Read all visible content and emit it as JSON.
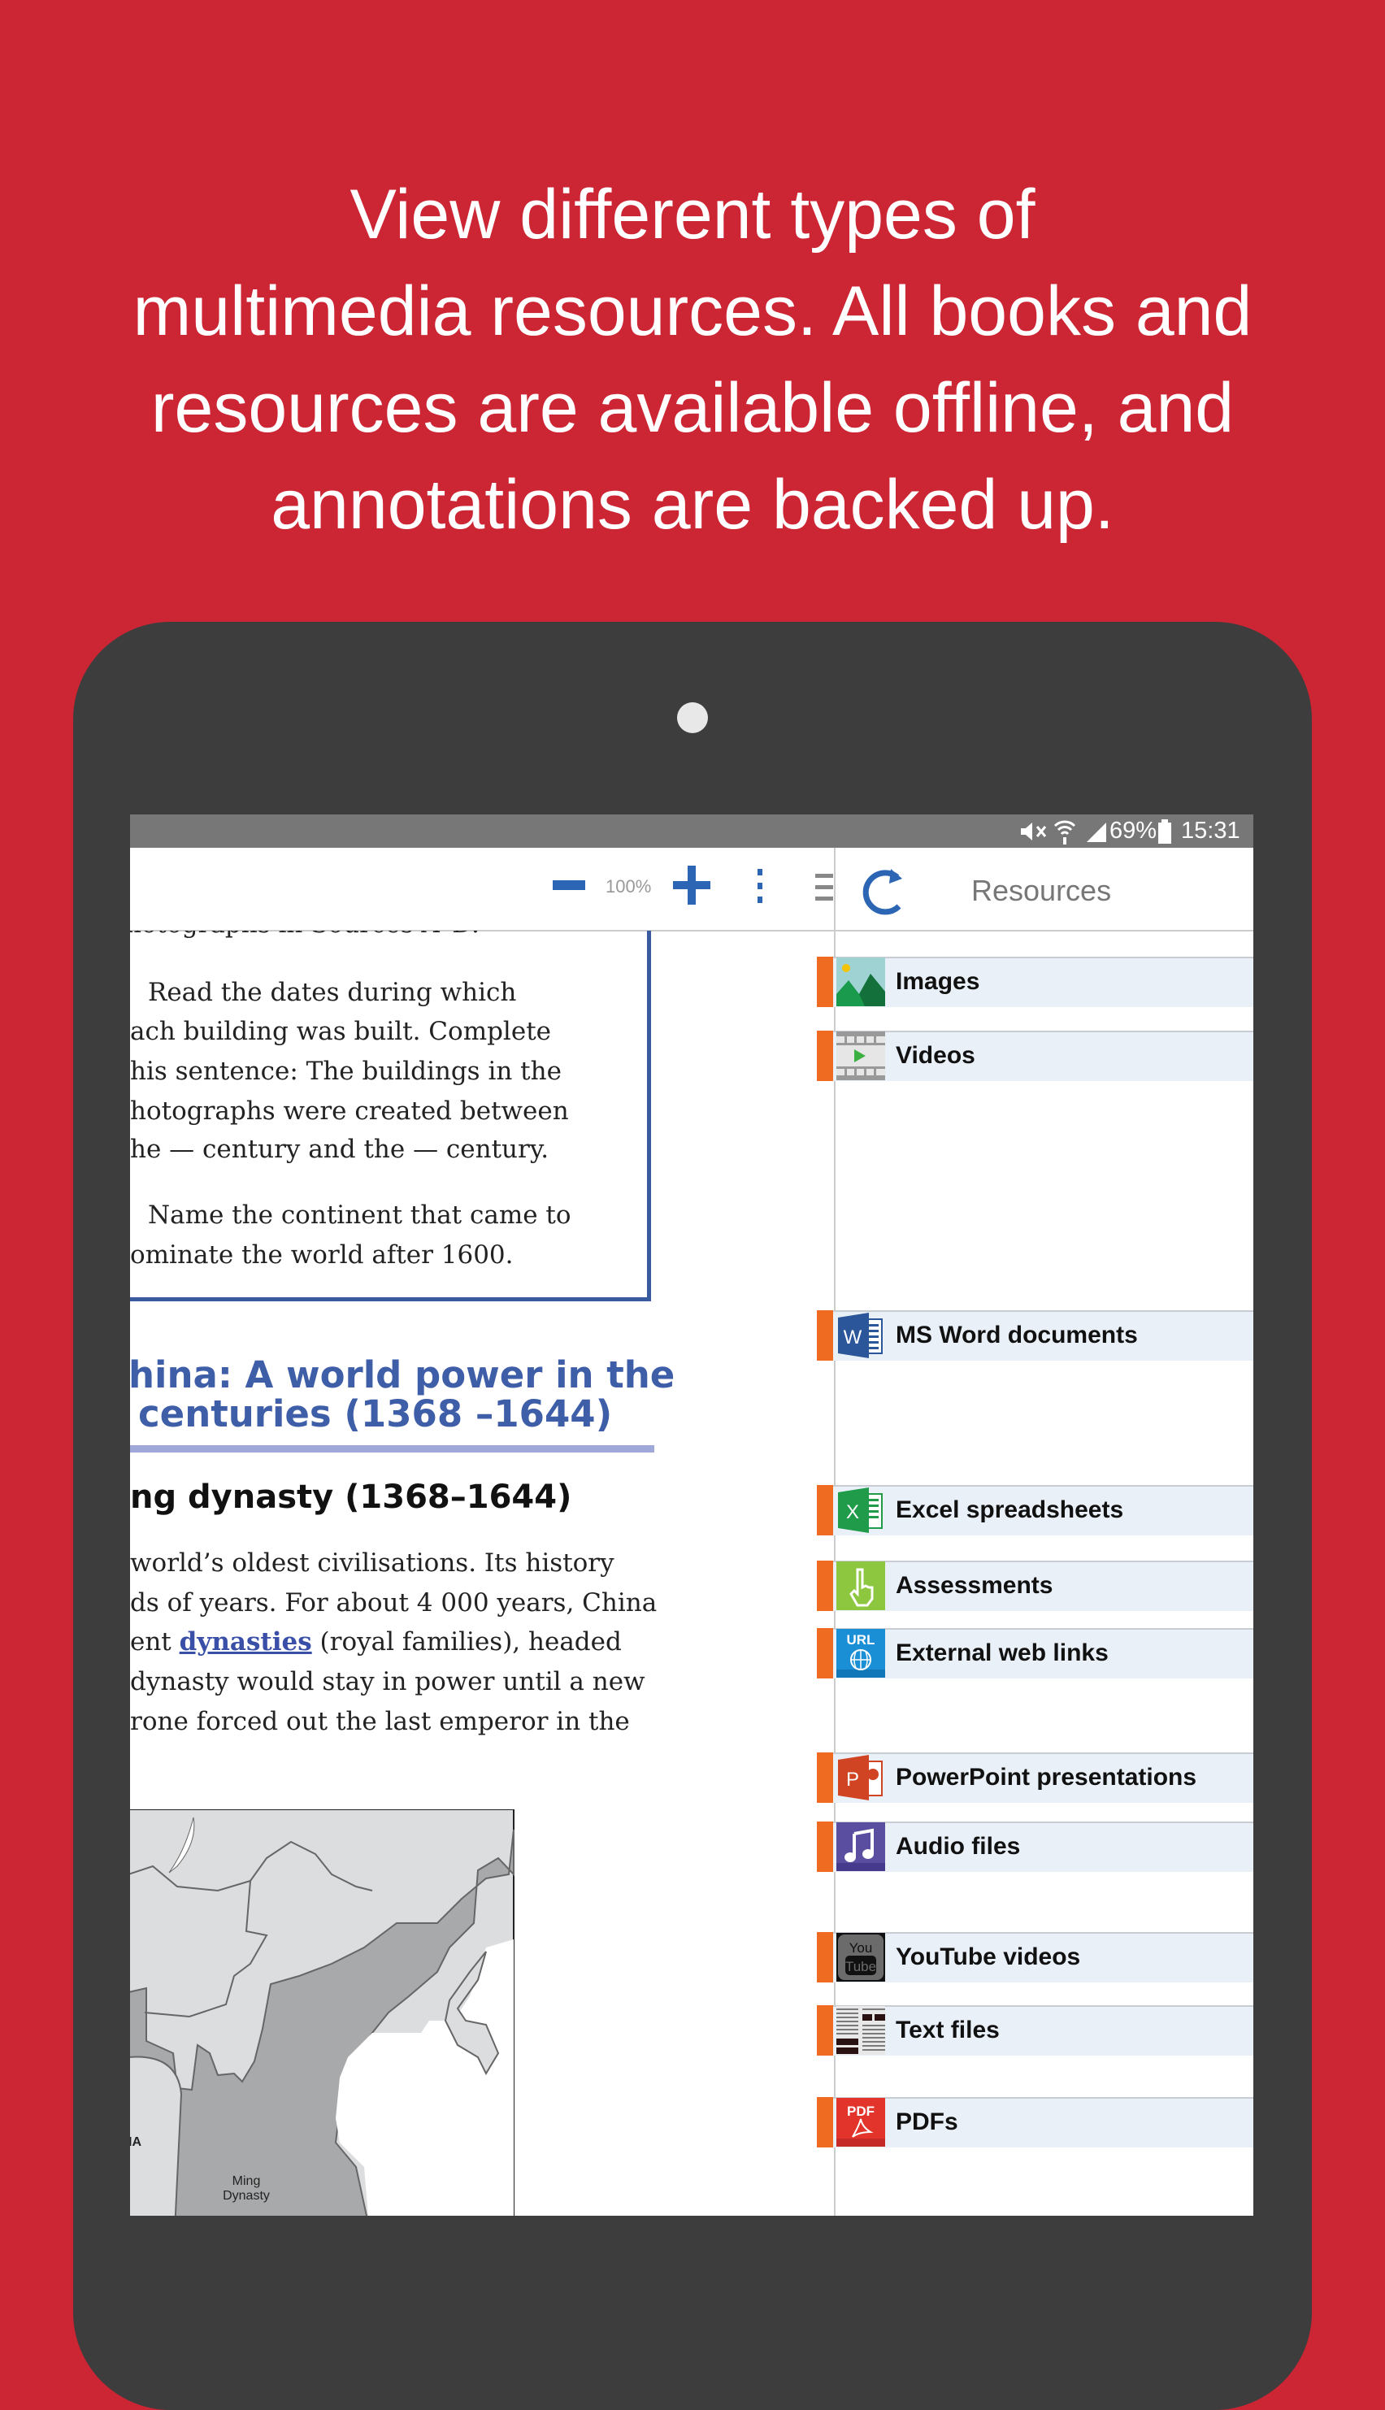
{
  "headline": {
    "lines": [
      "View different types of",
      "multimedia resources. All books and",
      "resources are available offline, and",
      "annotations are backed up."
    ]
  },
  "status_bar": {
    "icons": [
      "mute-icon",
      "wifi-icon",
      "signal-icon",
      "battery-icon"
    ],
    "battery": "69%",
    "time": "15:31"
  },
  "toolbar": {
    "zoom_level": "100%",
    "zoom_out_icon": "minus-icon",
    "zoom_in_icon": "plus-icon",
    "more_icon": "more-vertical-icon",
    "menu_icon": "hamburger-icon",
    "refresh_icon": "refresh-icon",
    "panel_title": "Resources"
  },
  "book": {
    "top_cut_line": "hotographs in Sources A–D.",
    "box_lines": [
      "Read the dates during which",
      "ach building was built. Complete",
      "his sentence: The buildings in the",
      "hotographs were created between",
      "he — century and the — century.",
      "Name the continent that came to",
      "ominate the world after 1600."
    ],
    "heading_lines": [
      "hina: A world power in the",
      "centuries (1368 –1644)"
    ],
    "subheading": "ng dynasty (1368–1644)",
    "paragraph": [
      {
        "text": "world’s oldest civilisations. Its history"
      },
      {
        "text": "ds of years. For about 4 000 years, China"
      },
      {
        "pre": "ent ",
        "link": "dynasties",
        "post": " (royal families), headed"
      },
      {
        "text": "dynasty would stay in power until a new"
      },
      {
        "text": "rone forced out the last emperor in the"
      }
    ],
    "map": {
      "label_region": "Ming\nDynasty",
      "label_region_line1": "Ming",
      "label_region_line2": "Dynasty",
      "label_cut": "IA"
    }
  },
  "resources": [
    {
      "label": "Images",
      "icon": "image-icon"
    },
    {
      "label": "Videos",
      "icon": "video-icon"
    },
    {
      "label": "MS Word documents",
      "icon": "word-icon"
    },
    {
      "label": "Excel spreadsheets",
      "icon": "excel-icon"
    },
    {
      "label": "Assessments",
      "icon": "assessment-hand-icon"
    },
    {
      "label": "External web links",
      "icon": "url-globe-icon"
    },
    {
      "label": "PowerPoint presentations",
      "icon": "powerpoint-icon"
    },
    {
      "label": "Audio files",
      "icon": "audio-note-icon"
    },
    {
      "label": "YouTube videos",
      "icon": "youtube-icon"
    },
    {
      "label": "Text files",
      "icon": "text-file-icon"
    },
    {
      "label": "PDFs",
      "icon": "pdf-icon"
    }
  ],
  "colors": {
    "background": "#cc2534",
    "tablet": "#3d3d3d",
    "accent_blue": "#3f5ea8",
    "resource_bar": "#f06b22",
    "resource_row": "#eaf0f8"
  }
}
